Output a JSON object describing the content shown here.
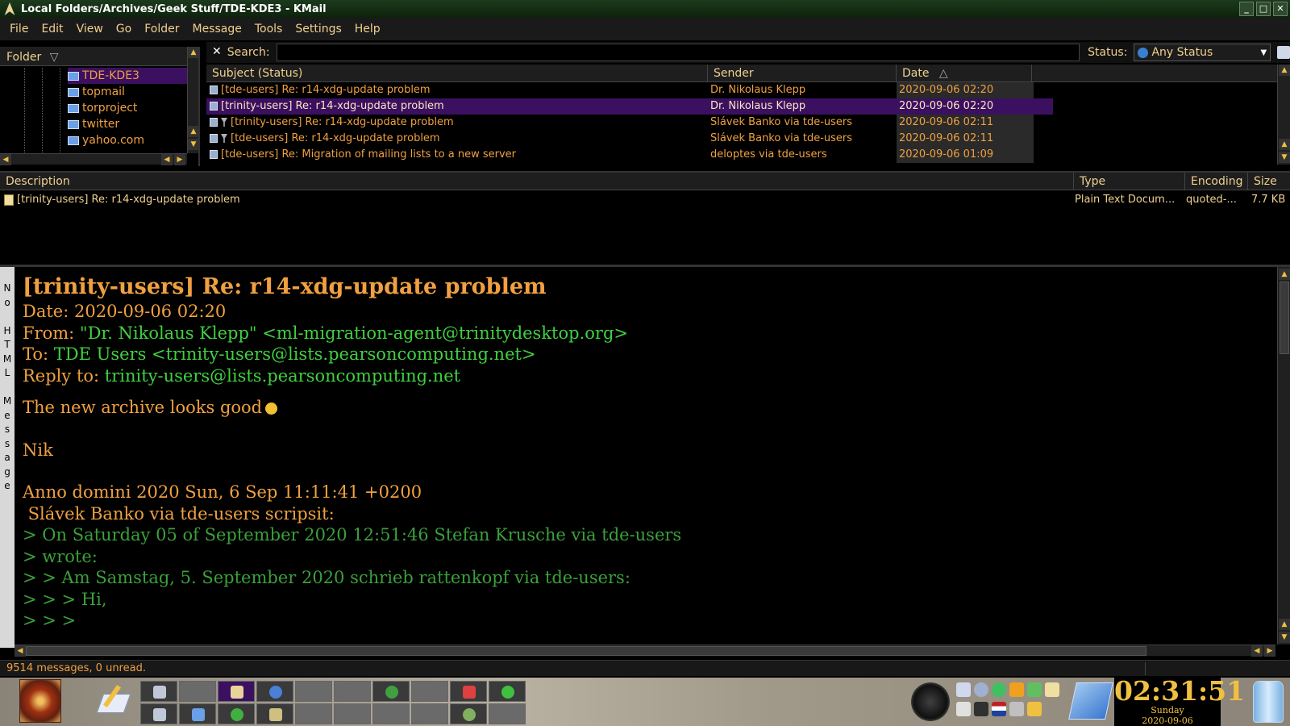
{
  "window": {
    "title": "Local Folders/Archives/Geek Stuff/TDE-KDE3 - KMail"
  },
  "menu": [
    "File",
    "Edit",
    "View",
    "Go",
    "Folder",
    "Message",
    "Tools",
    "Settings",
    "Help"
  ],
  "folders": {
    "header": "Folder",
    "items": [
      "TDE-KDE3",
      "topmail",
      "torproject",
      "twitter",
      "yahoo.com"
    ]
  },
  "search": {
    "label": "Search:",
    "value": "",
    "status_label": "Status:",
    "status_value": "Any Status"
  },
  "message_list": {
    "columns": {
      "subject": "Subject (Status)",
      "sender": "Sender",
      "date": "Date"
    },
    "rows": [
      {
        "subject": "[tde-users] Re: r14-xdg-update problem",
        "sender": "Dr. Nikolaus Klepp",
        "date": "2020-09-06 02:20"
      },
      {
        "subject": "[trinity-users] Re: r14-xdg-update problem",
        "sender": "Dr. Nikolaus Klepp",
        "date": "2020-09-06 02:20"
      },
      {
        "subject": "[trinity-users] Re: r14-xdg-update problem",
        "sender": "Slávek Banko via tde-users",
        "date": "2020-09-06 02:11"
      },
      {
        "subject": "[tde-users] Re: r14-xdg-update problem",
        "sender": "Slávek Banko via tde-users",
        "date": "2020-09-06 02:11"
      },
      {
        "subject": "[tde-users] Re: Migration of mailing lists to a new server",
        "sender": "deloptes via tde-users",
        "date": "2020-09-06 01:09"
      }
    ]
  },
  "attachments": {
    "columns": {
      "description": "Description",
      "type": "Type",
      "encoding": "Encoding",
      "size": "Size"
    },
    "rows": [
      {
        "description": "[trinity-users] Re: r14-xdg-update problem",
        "type": "Plain Text Docum...",
        "encoding": "quoted-...",
        "size": "7.7 KB"
      }
    ]
  },
  "reader": {
    "side_label": [
      "N",
      "o",
      "",
      "H",
      "T",
      "M",
      "L",
      "",
      "M",
      "e",
      "s",
      "s",
      "a",
      "g",
      "e"
    ],
    "subject": "[trinity-users] Re: r14-xdg-update problem",
    "date_label": "Date: ",
    "date": "2020-09-06 02:20",
    "from_label": "From: ",
    "from": "\"Dr. Nikolaus Klepp\" <ml-migration-agent@trinitydesktop.org>",
    "to_label": "To: ",
    "to": "TDE Users <trinity-users@lists.pearsoncomputing.net>",
    "reply_label": "Reply to: ",
    "reply_to": "trinity-users@lists.pearsoncomputing.net",
    "body_line1": "The new archive looks good",
    "body_sig": "Nik",
    "body_anno": "Anno domini 2020 Sun, 6 Sep 11:11:41 +0200",
    "body_scripsit": " Slávek Banko via tde-users scripsit:",
    "quotes": [
      "> On Saturday 05 of September 2020 12:51:46 Stefan Krusche via tde-users",
      "> wrote:",
      "> > Am Samstag, 5. September 2020 schrieb rattenkopf via tde-users:",
      "> > > Hi,",
      "> > >"
    ]
  },
  "statusbar": {
    "text": "9514 messages, 0 unread."
  },
  "clock": {
    "time": "02:31:51",
    "day": "Sunday",
    "date": "2020-09-06"
  },
  "colors": {
    "accent": "#f0a040",
    "selection": "#3c1060",
    "link_green": "#40d040",
    "quote_green": "#3aa03a"
  }
}
